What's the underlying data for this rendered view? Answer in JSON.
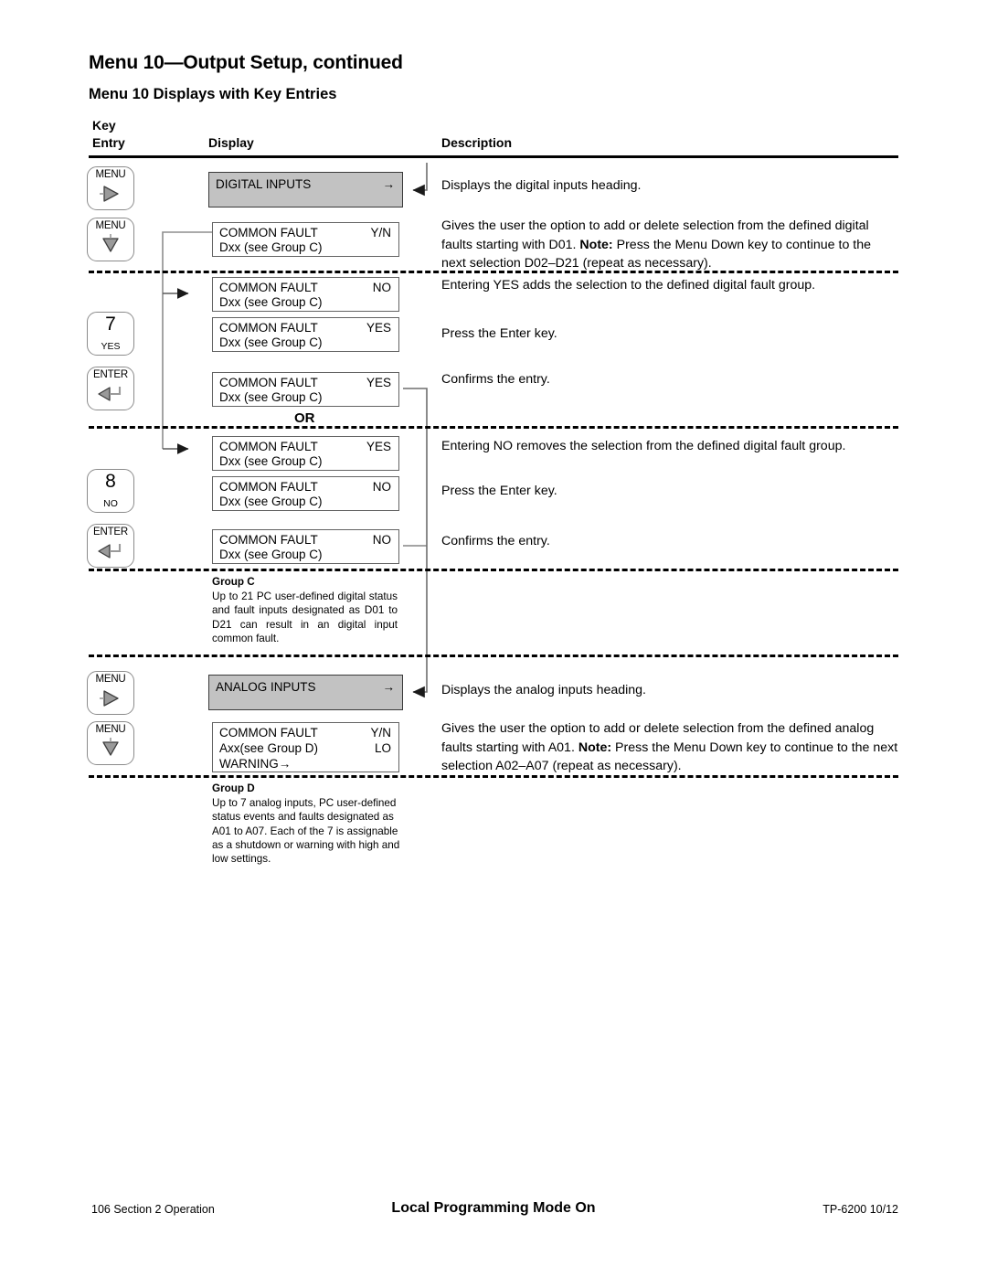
{
  "document": {
    "title": "Menu 10—Output Setup, continued",
    "subtitle": "Menu 10 Displays with Key Entries"
  },
  "table_headers": {
    "key": "Key",
    "entry": "Entry",
    "display": "Display",
    "description": "Description"
  },
  "keys": {
    "menu_right": {
      "label": "MENU",
      "icon": "arrow-right-icon"
    },
    "menu_down": {
      "label": "MENU",
      "icon": "arrow-down-icon"
    },
    "seven_yes": {
      "big": "7",
      "sub": "YES"
    },
    "eight_no": {
      "big": "8",
      "sub": "NO"
    },
    "enter": {
      "label": "ENTER",
      "icon": "enter-arrow-icon"
    }
  },
  "displays": {
    "digital_inputs": {
      "line1_left": "DIGITAL INPUTS",
      "line1_right": "→"
    },
    "common_fault_yn": {
      "line1_left": "COMMON FAULT",
      "line1_right": "Y/N",
      "line2_left": "Dxx (see Group C)"
    },
    "common_fault_no_1": {
      "line1_left": "COMMON FAULT",
      "line1_right": "NO",
      "line2_left": "Dxx (see Group C)"
    },
    "common_fault_yes_1": {
      "line1_left": "COMMON FAULT",
      "line1_right": "YES",
      "line2_left": "Dxx (see Group C)"
    },
    "common_fault_yes_2": {
      "line1_left": "COMMON FAULT",
      "line1_right": "YES",
      "line2_left": "Dxx (see Group C)"
    },
    "common_fault_yes_3": {
      "line1_left": "COMMON FAULT",
      "line1_right": "YES",
      "line2_left": "Dxx (see Group C)"
    },
    "common_fault_no_2": {
      "line1_left": "COMMON FAULT",
      "line1_right": "NO",
      "line2_left": "Dxx (see Group C)"
    },
    "common_fault_no_3": {
      "line1_left": "COMMON FAULT",
      "line1_right": "NO",
      "line2_left": "Dxx (see Group C)"
    },
    "analog_inputs": {
      "line1_left": "ANALOG INPUTS",
      "line1_right": "→"
    },
    "common_fault_analog": {
      "line1_left": "COMMON FAULT",
      "line1_right": "Y/N",
      "line2_left": "Axx(see Group D)",
      "line2_right": "LO",
      "line3_left": "WARNING→"
    }
  },
  "or_label": "OR",
  "descriptions": {
    "digital_heading": "Displays the digital inputs heading.",
    "digital_yn_pre": "Gives the user the option to add or delete selection from the defined digital faults starting with D01. ",
    "digital_yn_note": "Note:",
    "digital_yn_post": " Press the Menu Down key to continue to the next selection D02–D21 (repeat as necessary).",
    "entering_yes": "Entering YES adds the selection to the defined digital fault group.",
    "press_enter_1": "Press the Enter key.",
    "confirms_1": "Confirms the entry.",
    "entering_no": "Entering NO removes the selection from the defined digital fault group.",
    "press_enter_2": "Press the Enter key.",
    "confirms_2": "Confirms the entry.",
    "analog_heading": "Displays the analog inputs heading.",
    "analog_yn_pre": "Gives the user the option to add or delete selection from the defined analog faults starting with A01. ",
    "analog_yn_note": "Note:",
    "analog_yn_post": " Press the Menu Down key to continue to the next selection A02–A07 (repeat as necessary)."
  },
  "groups": {
    "group_c": {
      "title": "Group C",
      "body": "Up to 21 PC user-defined digital status and fault inputs designated as D01 to D21 can result in an digital input common fault."
    },
    "group_d": {
      "title": "Group D",
      "body": "Up to 7 analog inputs, PC user-defined status events and faults designated as A01 to A07. Each of the 7 is assignable as a shutdown or warning with high and low settings."
    }
  },
  "footer": {
    "left": "106  Section 2  Operation",
    "center": "Local Programming Mode On",
    "right": "TP-6200  10/12"
  },
  "colors": {
    "display_fill": "#c2c2c2",
    "border": "#636363",
    "key_border": "#8b8b8b",
    "ink": "#000000"
  }
}
